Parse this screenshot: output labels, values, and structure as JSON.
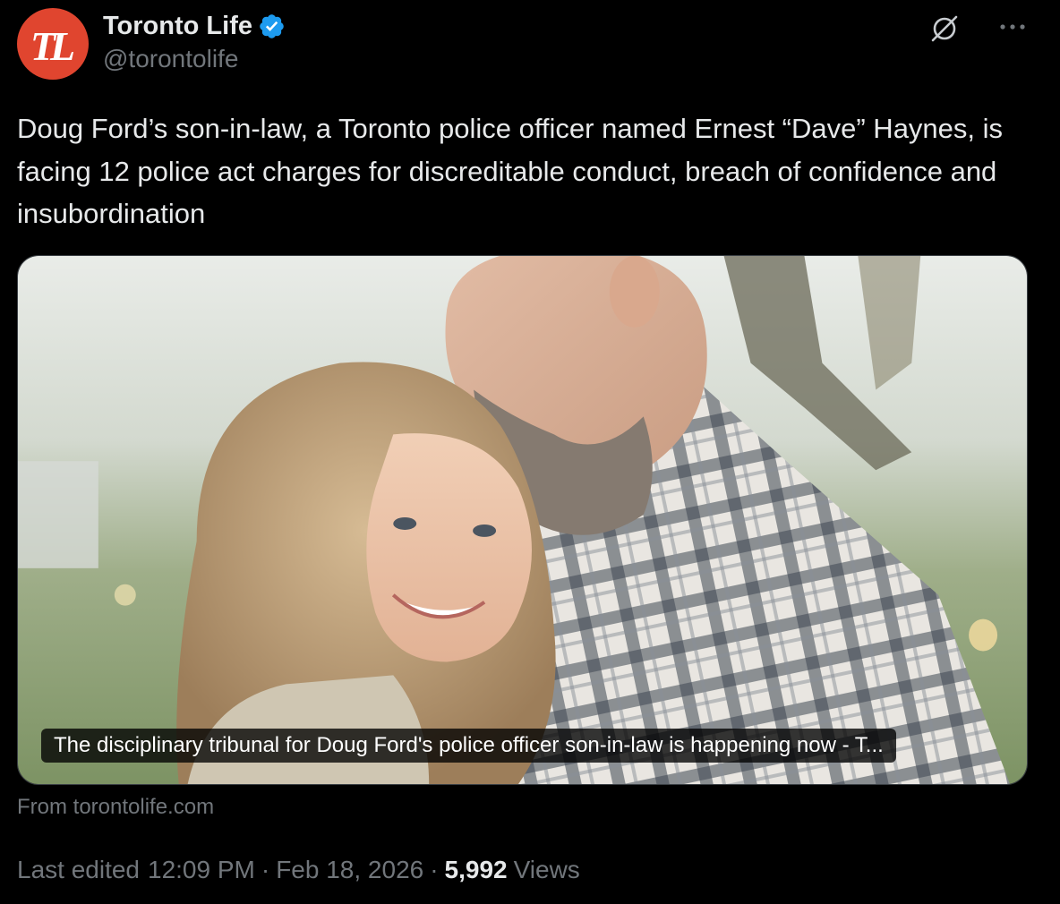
{
  "account": {
    "avatar_letters": "TL",
    "display_name": "Toronto Life",
    "handle": "@torontolife",
    "verified": true
  },
  "header_icons": {
    "grok": "grok-icon",
    "more": "more-icon"
  },
  "tweet": {
    "text": "Doug Ford’s son-in-law, a Toronto police officer named Ernest “Dave” Haynes, is facing 12 police act charges for discreditable conduct, breach of confidence and insubordination"
  },
  "link_card": {
    "caption": "The disciplinary tribunal for Doug Ford's police officer son-in-law is happening now - T...",
    "source": "From torontolife.com"
  },
  "meta": {
    "edited_label": "Last edited",
    "time": "12:09 PM",
    "date": "Feb 18, 2026",
    "separator": "·",
    "views_count": "5,992",
    "views_label": "Views"
  },
  "colors": {
    "background": "#000000",
    "text_primary": "#e7e9ea",
    "text_secondary": "#71767b",
    "avatar_brand": "#e0452f",
    "verified_blue": "#1d9bf0"
  }
}
